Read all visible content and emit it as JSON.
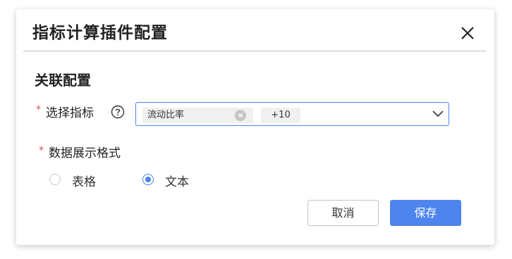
{
  "dialog": {
    "title": "指标计算插件配置",
    "close_icon": "close-icon"
  },
  "section": {
    "title": "关联配置"
  },
  "indicator": {
    "required_mark": "*",
    "label": "选择指标",
    "help_icon": "question-circle-icon",
    "tags": [
      {
        "label": "流动比率",
        "removable": true
      },
      {
        "label": "+10",
        "removable": false
      }
    ],
    "dropdown_icon": "chevron-down-icon"
  },
  "display_format": {
    "required_mark": "*",
    "label": "数据展示格式",
    "options": [
      {
        "label": "表格",
        "selected": false
      },
      {
        "label": "文本",
        "selected": true
      }
    ]
  },
  "footer": {
    "cancel_label": "取消",
    "save_label": "保存"
  },
  "colors": {
    "primary": "#4d84ee",
    "required": "#e5484d"
  }
}
